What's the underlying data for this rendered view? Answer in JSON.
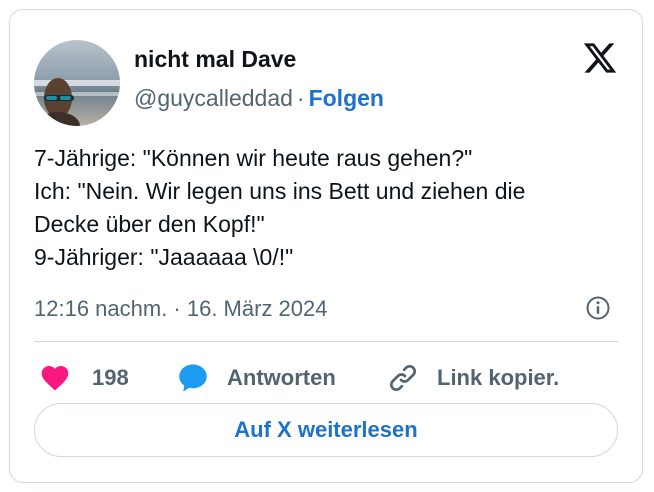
{
  "author": {
    "name": "nicht mal Dave",
    "handle": "@guycalleddad",
    "separator": "·",
    "follow_label": "Folgen"
  },
  "tweet": {
    "lines": [
      "7-Jährige: \"Können wir heute raus gehen?\"",
      "Ich: \"Nein. Wir legen uns ins Bett und ziehen die",
      "Decke über den Kopf!\"",
      "9-Jähriger: \"Jaaaaaa \\0/!\""
    ],
    "timestamp": "12:16 nachm. · 16. März 2024"
  },
  "actions": {
    "like_count": "198",
    "reply_label": "Antworten",
    "copy_link_label": "Link kopier."
  },
  "cta_label": "Auf X weiterlesen",
  "colors": {
    "accent": "#1d72c9",
    "heart": "#f91880",
    "text": "#0f1419",
    "muted": "#536471",
    "border": "#cfd9de"
  },
  "icons": [
    "x-logo-icon",
    "info-icon",
    "heart-icon",
    "reply-bubble-icon",
    "link-icon"
  ]
}
